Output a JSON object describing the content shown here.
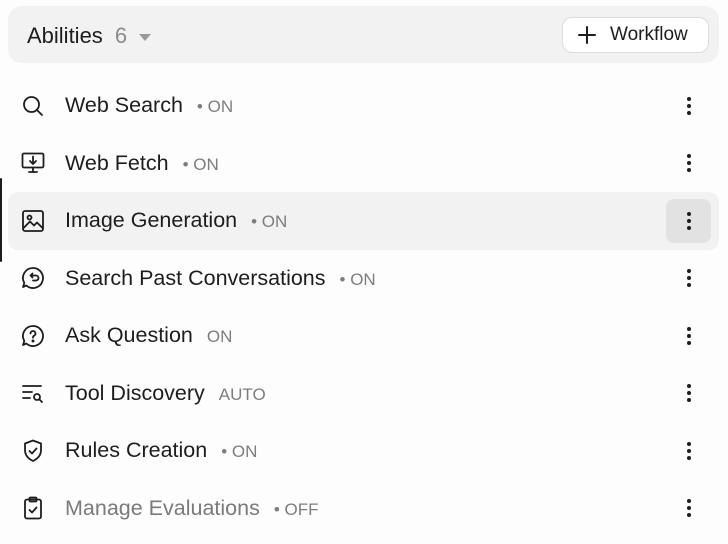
{
  "header": {
    "title": "Abilities",
    "count": "6",
    "workflow_label": "Workflow"
  },
  "abilities": [
    {
      "name": "Web Search",
      "status": "• ON",
      "icon": "search-icon"
    },
    {
      "name": "Web Fetch",
      "status": "• ON",
      "icon": "monitor-download-icon"
    },
    {
      "name": "Image Generation",
      "status": "• ON",
      "icon": "image-icon",
      "selected": true
    },
    {
      "name": "Search Past Conversations",
      "status": "• ON",
      "icon": "history-chat-icon"
    },
    {
      "name": "Ask Question",
      "status": "ON",
      "icon": "question-chat-icon"
    },
    {
      "name": "Tool Discovery",
      "status": "AUTO",
      "icon": "list-search-icon"
    },
    {
      "name": "Rules Creation",
      "status": "• ON",
      "icon": "shield-check-icon"
    },
    {
      "name": "Manage Evaluations",
      "status": "• OFF",
      "icon": "clipboard-check-icon",
      "disabled": true
    }
  ]
}
